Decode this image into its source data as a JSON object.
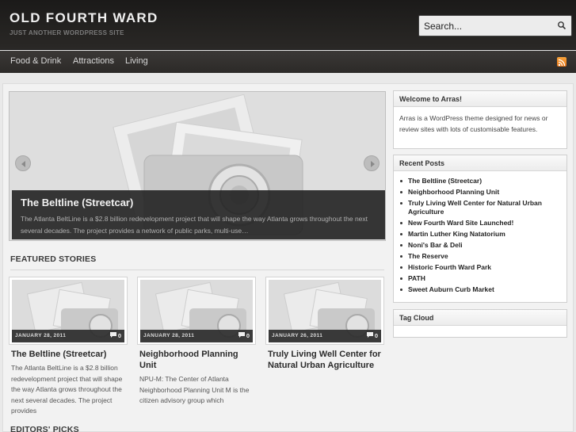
{
  "header": {
    "site_title": "OLD FOURTH WARD",
    "tagline": "JUST ANOTHER WORDPRESS SITE",
    "search_placeholder": "Search...",
    "search_icon": "search-icon"
  },
  "nav": {
    "items": [
      {
        "label": "Food & Drink"
      },
      {
        "label": "Attractions"
      },
      {
        "label": "Living"
      }
    ],
    "rss_icon": "rss-icon"
  },
  "slider": {
    "title": "The Beltline (Streetcar)",
    "excerpt": "The Atlanta BeltLine is a $2.8 billion redevelopment project that will shape the way Atlanta grows throughout the next several decades. The project provides a network of public parks, multi-use…"
  },
  "featured": {
    "heading": "FEATURED STORIES",
    "cards": [
      {
        "date": "JANUARY 28, 2011",
        "comments": "0",
        "title": "The Beltline (Streetcar)",
        "excerpt": "The Atlanta BeltLine is a $2.8 billion redevelopment project that will shape the way Atlanta grows throughout the next several decades. The project provides"
      },
      {
        "date": "JANUARY 28, 2011",
        "comments": "0",
        "title": "Neighborhood Planning Unit",
        "excerpt": "NPU-M: The Center of Atlanta Neighborhood Planning Unit M is the citizen advisory group which"
      },
      {
        "date": "JANUARY 26, 2011",
        "comments": "0",
        "title": "Truly Living Well Center for Natural Urban Agriculture",
        "excerpt": ""
      }
    ]
  },
  "editors_picks": {
    "heading": "EDITORS' PICKS"
  },
  "sidebar": {
    "welcome": {
      "title": "Welcome to Arras!",
      "text": "Arras is a WordPress theme designed for news or review sites with lots of customisable features."
    },
    "recent": {
      "title": "Recent Posts",
      "items": [
        "The Beltline (Streetcar)",
        "Neighborhood Planning Unit",
        "Truly Living Well Center for Natural Urban Agriculture",
        "New Fourth Ward Site Launched!",
        "Martin Luther King Natatorium",
        "Noni's Bar & Deli",
        "The Reserve",
        "Historic Fourth Ward Park",
        "PATH",
        "Sweet Auburn Curb Market"
      ]
    },
    "tagcloud": {
      "title": "Tag Cloud"
    }
  },
  "colors": {
    "header_bg": "#1b1a19",
    "nav_bg": "#3b3836",
    "rss_orange": "#f08a24",
    "page_bg": "#e9e9e9"
  }
}
